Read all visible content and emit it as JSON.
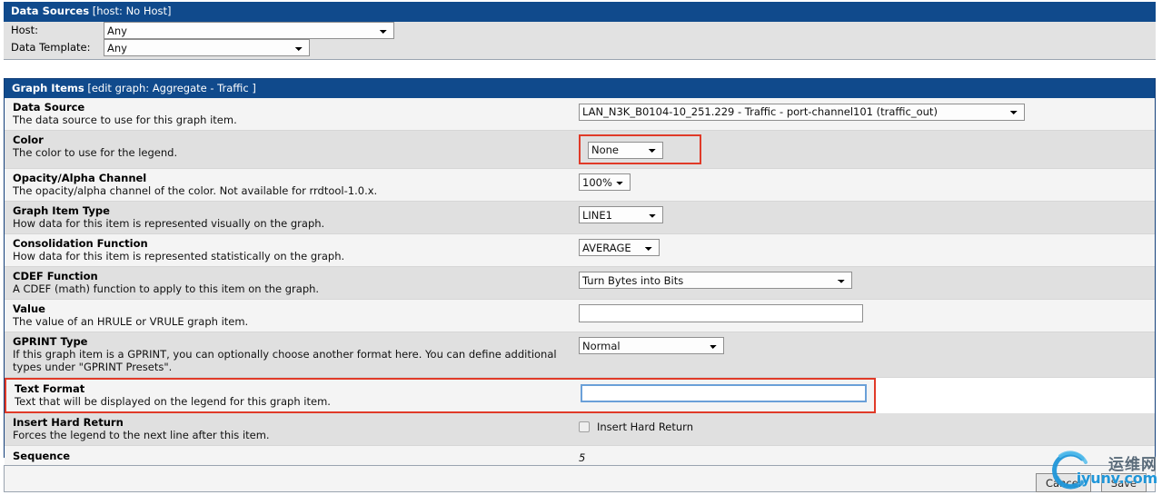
{
  "data_sources": {
    "header_title": "Data Sources",
    "header_sub": "[host: No Host]",
    "host_label": "Host:",
    "host_value": "Any",
    "data_template_label": "Data Template:",
    "data_template_value": "Any"
  },
  "graph_items": {
    "header_title": "Graph Items",
    "header_sub": "[edit graph: Aggregate - Traffic ]",
    "rows": [
      {
        "title": "Data Source",
        "desc": "The data source to use for this graph item.",
        "value": "LAN_N3K_B0104-10_251.229 - Traffic - port-channel101 (traffic_out)"
      },
      {
        "title": "Color",
        "desc": "The color to use for the legend.",
        "value": "None"
      },
      {
        "title": "Opacity/Alpha Channel",
        "desc": "The opacity/alpha channel of the color. Not available for rrdtool-1.0.x.",
        "value": "100%"
      },
      {
        "title": "Graph Item Type",
        "desc": "How data for this item is represented visually on the graph.",
        "value": "LINE1"
      },
      {
        "title": "Consolidation Function",
        "desc": "How data for this item is represented statistically on the graph.",
        "value": "AVERAGE"
      },
      {
        "title": "CDEF Function",
        "desc": "A CDEF (math) function to apply to this item on the graph.",
        "value": "Turn Bytes into Bits"
      },
      {
        "title": "Value",
        "desc": "The value of an HRULE or VRULE graph item.",
        "value": ""
      },
      {
        "title": "GPRINT Type",
        "desc": "If this graph item is a GPRINT, you can optionally choose another format here. You can define additional",
        "desc2": "types under \"GPRINT Presets\".",
        "value": "Normal"
      },
      {
        "title": "Text Format",
        "desc": "Text that will be displayed on the legend for this graph item.",
        "value": ""
      },
      {
        "title": "Insert Hard Return",
        "desc": "Forces the legend to the next line after this item.",
        "checkbox_label": "Insert Hard Return",
        "checked": false
      },
      {
        "title": "Sequence",
        "desc": "",
        "value": "5"
      }
    ]
  },
  "buttons": {
    "cancel": "Cancel",
    "save": "Save"
  },
  "watermark": {
    "cn": "运维网",
    "en": "iyunv.com",
    "logo_color": "#2096d8"
  },
  "colors": {
    "header_bg": "#104A8C",
    "highlight": "#e03a28",
    "focus_border": "#6aa0d8",
    "row_alt": "#e0e0e0",
    "row_base": "#f4f4f4"
  }
}
